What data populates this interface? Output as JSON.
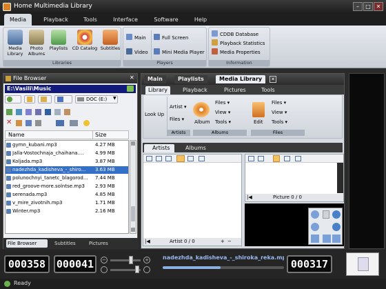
{
  "window": {
    "title": "Home Multimedia Library"
  },
  "menu": [
    "Media",
    "Playback",
    "Tools",
    "Interface",
    "Software",
    "Help"
  ],
  "ribbon": {
    "libraries": {
      "caption": "Libraries",
      "buttons": [
        "Media Library",
        "Photo Albums",
        "Playlists",
        "CD Catalog",
        "Subtitles"
      ]
    },
    "players": {
      "caption": "Players",
      "items": [
        "Main",
        "Video",
        "Full Screen",
        "Mini Media Player"
      ]
    },
    "information": {
      "caption": "Information",
      "items": [
        "CDDB Database",
        "Playback Statistics",
        "Media Properties"
      ]
    }
  },
  "file_browser": {
    "title": "File Browser",
    "path": "E:\\Vasili\\Music",
    "drive": "DOC (E:)",
    "columns": {
      "name": "Name",
      "size": "Size"
    },
    "files": [
      {
        "name": "gymn_kubani.mp3",
        "size": "4.27 MB"
      },
      {
        "name": "Jalla-Vostochnaja_chaihana....",
        "size": "4.99 MB"
      },
      {
        "name": "Koljada.mp3",
        "size": "3.87 MB"
      },
      {
        "name": "nadezhda_kadisheva_-_shiro...",
        "size": "3.63 MB"
      },
      {
        "name": "polunochnyi_tanetc_blagorod...",
        "size": "7.44 MB"
      },
      {
        "name": "red_groove-more.solntse.mp3",
        "size": "2.93 MB"
      },
      {
        "name": "serenada.mp3",
        "size": "4.85 MB"
      },
      {
        "name": "v_mire_zivotnih.mp3",
        "size": "1.71 MB"
      },
      {
        "name": "Winter.mp3",
        "size": "2.16 MB"
      }
    ],
    "tabs": [
      "File Browser",
      "Subtitles",
      "Pictures"
    ]
  },
  "main": {
    "tabs": [
      "Main",
      "Playlists",
      "Media Library"
    ],
    "sub_tabs": [
      "Library",
      "Playback",
      "Pictures",
      "Tools"
    ],
    "sub_ribbon": {
      "look_up": "Look Up",
      "artists": {
        "caption": "Artists",
        "items": [
          "Artist",
          "Files"
        ]
      },
      "albums": {
        "caption": "Albums",
        "album": "Album",
        "items": [
          "Files",
          "View",
          "Tools"
        ]
      },
      "files": {
        "caption": "Files",
        "edit": "Edit",
        "items": [
          "Files",
          "View",
          "Tools"
        ]
      }
    },
    "view_tabs": [
      "Artists",
      "Albums"
    ],
    "artist_status": "Artist 0 / 0",
    "picture_status": "Picture 0 / 0"
  },
  "player": {
    "time_elapsed": "000358",
    "time_second": "000041",
    "time_remaining": "000317",
    "track": "nadezhda_kadisheva_-_shiroka_reka.mp3",
    "progress": 0.48,
    "volume": 0.7
  },
  "status": {
    "text": "Ready"
  }
}
